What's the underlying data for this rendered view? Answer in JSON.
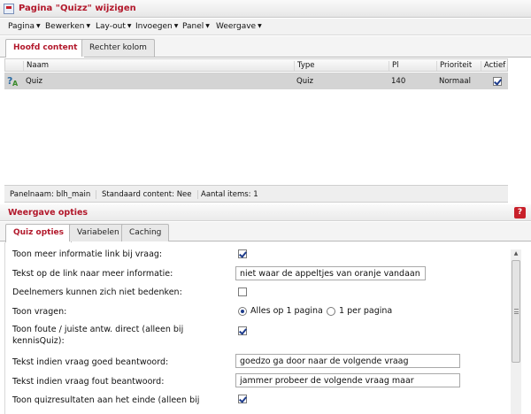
{
  "window": {
    "title": "Pagina \"Quizz\" wijzigen"
  },
  "menu": {
    "items": [
      {
        "label": "Pagina"
      },
      {
        "label": "Bewerken"
      },
      {
        "label": "Lay-out"
      },
      {
        "label": "Invoegen"
      },
      {
        "label": "Panel"
      },
      {
        "label": "Weergave"
      }
    ]
  },
  "content_tabs": [
    {
      "label": "Hoofd content",
      "active": true
    },
    {
      "label": "Rechter kolom",
      "active": false
    }
  ],
  "table": {
    "columns": [
      "Naam",
      "Type",
      "Pl",
      "Prioriteit",
      "Actief"
    ],
    "rows": [
      {
        "icon": "quiz-icon",
        "name": "Quiz",
        "type": "Quiz",
        "pl": "140",
        "priority": "Normaal",
        "active": true
      }
    ]
  },
  "status": {
    "panel_name": "Panelnaam: blh_main",
    "default_content": "Standaard content: Nee",
    "item_count": "Aantal items: 1"
  },
  "display_options": {
    "title": "Weergave opties",
    "help_icon": "?",
    "tabs": [
      {
        "label": "Quiz opties",
        "active": true
      },
      {
        "label": "Variabelen",
        "active": false
      },
      {
        "label": "Caching",
        "active": false
      }
    ]
  },
  "quiz_options": {
    "show_more_info_link": {
      "label": "Toon meer informatie link bij vraag:",
      "checked": true
    },
    "more_info_link_text": {
      "label": "Tekst op de link naar meer informatie:",
      "value": "niet waar de appeltjes van oranje vandaan k"
    },
    "participants_cannot_change": {
      "label": "Deelnemers kunnen zich niet bedenken:",
      "checked": false
    },
    "show_questions": {
      "label": "Toon vragen:",
      "options": [
        {
          "label": "Alles op 1 pagina",
          "selected": true
        },
        {
          "label": "1 per pagina",
          "selected": false
        }
      ]
    },
    "show_wrong_right": {
      "label_line1": "Toon foute / juiste antw. direct (alleen bij",
      "label_line2": "kennisQuiz):",
      "checked": true
    },
    "correct_answer_text": {
      "label": "Tekst indien vraag goed beantwoord:",
      "value": "goedzo ga door naar de volgende vraag"
    },
    "wrong_answer_text": {
      "label": "Tekst indien vraag fout beantwoord:",
      "value": "jammer probeer de volgende vraag maar"
    },
    "show_results_at_end": {
      "label": "Toon quizresultaten aan het einde (alleen bij",
      "checked": true
    }
  },
  "colors": {
    "accent": "#b2182b",
    "selected_row": "#d4d4d4",
    "check_mark": "#1e3c8c"
  }
}
